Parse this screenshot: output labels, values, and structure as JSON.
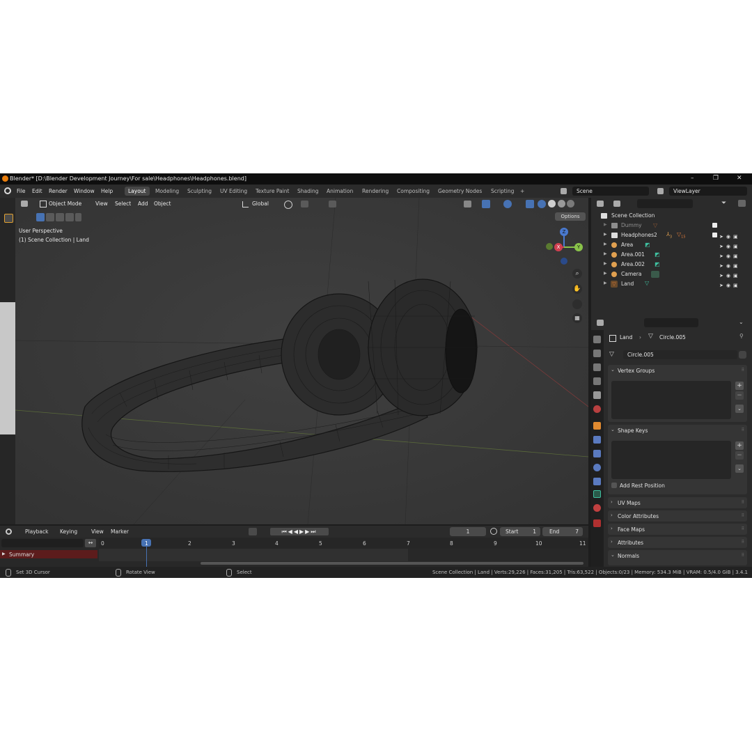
{
  "window": {
    "title": "Blender* [D:\\Blender Development Journey\\For sale\\Headphones\\Headphones.blend]",
    "controls": [
      "–",
      "❐",
      "✕"
    ]
  },
  "menu": [
    "File",
    "Edit",
    "Render",
    "Window",
    "Help"
  ],
  "workspaces": [
    "Layout",
    "Modeling",
    "Sculpting",
    "UV Editing",
    "Texture Paint",
    "Shading",
    "Animation",
    "Rendering",
    "Compositing",
    "Geometry Nodes",
    "Scripting",
    "+"
  ],
  "active_workspace": "Layout",
  "scene": {
    "name": "Scene",
    "view_layer": "ViewLayer"
  },
  "viewport": {
    "mode": "Object Mode",
    "header_menu": [
      "View",
      "Select",
      "Add",
      "Object"
    ],
    "transform_orientation": "Global",
    "options_label": "Options",
    "overlay_line1": "User Perspective",
    "overlay_line2": "(1) Scene Collection | Land",
    "gizmo": {
      "z": "Z",
      "y": "Y",
      "x": "X"
    }
  },
  "timeline": {
    "menu": [
      "Playback",
      "Keying",
      "View",
      "Marker"
    ],
    "current_frame": "1",
    "start_label": "Start",
    "start": "1",
    "end_label": "End",
    "end": "7",
    "ticks": [
      "0",
      "1",
      "2",
      "3",
      "4",
      "5",
      "6",
      "7",
      "8",
      "9",
      "10",
      "11"
    ],
    "summary_label": "Summary"
  },
  "status": {
    "left_hint": "Set 3D Cursor",
    "mid_hint": "Rotate View",
    "right_hint": "Select",
    "stats": "Scene Collection | Land | Verts:29,226 | Faces:31,205 | Tris:63,522 | Objects:0/23 | Memory: 534.3 MiB | VRAM: 0.5/4.0 GiB | 3.4.1"
  },
  "outliner": {
    "root": "Scene Collection",
    "items": [
      {
        "label": "Dummy",
        "color": "#e07b39"
      },
      {
        "label": "Headphones2",
        "badge1": "3",
        "badge2": "15",
        "color": "#cccccc"
      },
      {
        "label": "Area",
        "color": "#e0a050"
      },
      {
        "label": "Area.001",
        "color": "#e0a050"
      },
      {
        "label": "Area.002",
        "color": "#e0a050"
      },
      {
        "label": "Camera",
        "color": "#e0a050"
      },
      {
        "label": "Land",
        "color": "#e07b39"
      }
    ]
  },
  "properties": {
    "breadcrumb_object": "Land",
    "breadcrumb_mesh": "Circle.005",
    "mesh_name": "Circle.005",
    "panels": {
      "vertex_groups": "Vertex Groups",
      "shape_keys": "Shape Keys",
      "add_rest_position": "Add Rest Position",
      "uv_maps": "UV Maps",
      "color_attributes": "Color Attributes",
      "face_maps": "Face Maps",
      "attributes": "Attributes",
      "normals": "Normals"
    }
  },
  "colors": {
    "accent": "#4772b3",
    "frame_marker": "#4772b3",
    "summary": "#5c1c1c"
  }
}
